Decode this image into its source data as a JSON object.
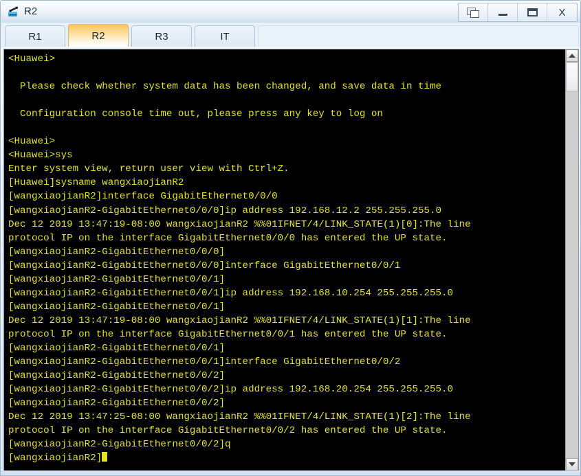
{
  "window": {
    "title": "R2",
    "app_icon": "router-icon",
    "controls": [
      {
        "name": "restore-button",
        "icon": "restore-icon",
        "label": ""
      },
      {
        "name": "minimize-button",
        "icon": "minimize-icon",
        "label": ""
      },
      {
        "name": "maximize-button",
        "icon": "maximize-icon",
        "label": ""
      },
      {
        "name": "close-button",
        "icon": "close-icon",
        "label": "X"
      }
    ],
    "frame_color": "#9fb6cd",
    "titlebar_gradient_top": "#fbfdfe",
    "titlebar_gradient_bottom": "#cddff0"
  },
  "tabs": {
    "items": [
      {
        "label": "R1",
        "active": false
      },
      {
        "label": "R2",
        "active": true
      },
      {
        "label": "R3",
        "active": false
      },
      {
        "label": "IT",
        "active": false
      }
    ],
    "active_index": 1,
    "active_color": "#fbc560"
  },
  "terminal": {
    "background": "#000000",
    "text_color": "#e3e327",
    "lines": [
      "<Huawei>",
      "",
      "  Please check whether system data has been changed, and save data in time",
      "",
      "  Configuration console time out, please press any key to log on",
      "",
      "<Huawei>",
      "<Huawei>sys",
      "Enter system view, return user view with Ctrl+Z.",
      "[Huawei]sysname wangxiaojianR2",
      "[wangxiaojianR2]interface GigabitEthernet0/0/0",
      "[wangxiaojianR2-GigabitEthernet0/0/0]ip address 192.168.12.2 255.255.255.0",
      "Dec 12 2019 13:47:19-08:00 wangxiaojianR2 %%01IFNET/4/LINK_STATE(1)[0]:The line",
      "protocol IP on the interface GigabitEthernet0/0/0 has entered the UP state.",
      "[wangxiaojianR2-GigabitEthernet0/0/0]",
      "[wangxiaojianR2-GigabitEthernet0/0/0]interface GigabitEthernet0/0/1",
      "[wangxiaojianR2-GigabitEthernet0/0/1]",
      "[wangxiaojianR2-GigabitEthernet0/0/1]ip address 192.168.10.254 255.255.255.0",
      "[wangxiaojianR2-GigabitEthernet0/0/1]",
      "Dec 12 2019 13:47:19-08:00 wangxiaojianR2 %%01IFNET/4/LINK_STATE(1)[1]:The line",
      "protocol IP on the interface GigabitEthernet0/0/1 has entered the UP state.",
      "[wangxiaojianR2-GigabitEthernet0/0/1]",
      "[wangxiaojianR2-GigabitEthernet0/0/1]interface GigabitEthernet0/0/2",
      "[wangxiaojianR2-GigabitEthernet0/0/2]",
      "[wangxiaojianR2-GigabitEthernet0/0/2]ip address 192.168.20.254 255.255.255.0",
      "[wangxiaojianR2-GigabitEthernet0/0/2]",
      "Dec 12 2019 13:47:25-08:00 wangxiaojianR2 %%01IFNET/4/LINK_STATE(1)[2]:The line",
      "protocol IP on the interface GigabitEthernet0/0/2 has entered the UP state.",
      "[wangxiaojianR2-GigabitEthernet0/0/2]q",
      "[wangxiaojianR2]"
    ],
    "prompt_line_index": 29,
    "cursor_visible": true
  },
  "scrollbar": {
    "up_arrow": "chevron-up-icon",
    "down_arrow": "chevron-down-icon",
    "thumb_position_percent": 3
  }
}
